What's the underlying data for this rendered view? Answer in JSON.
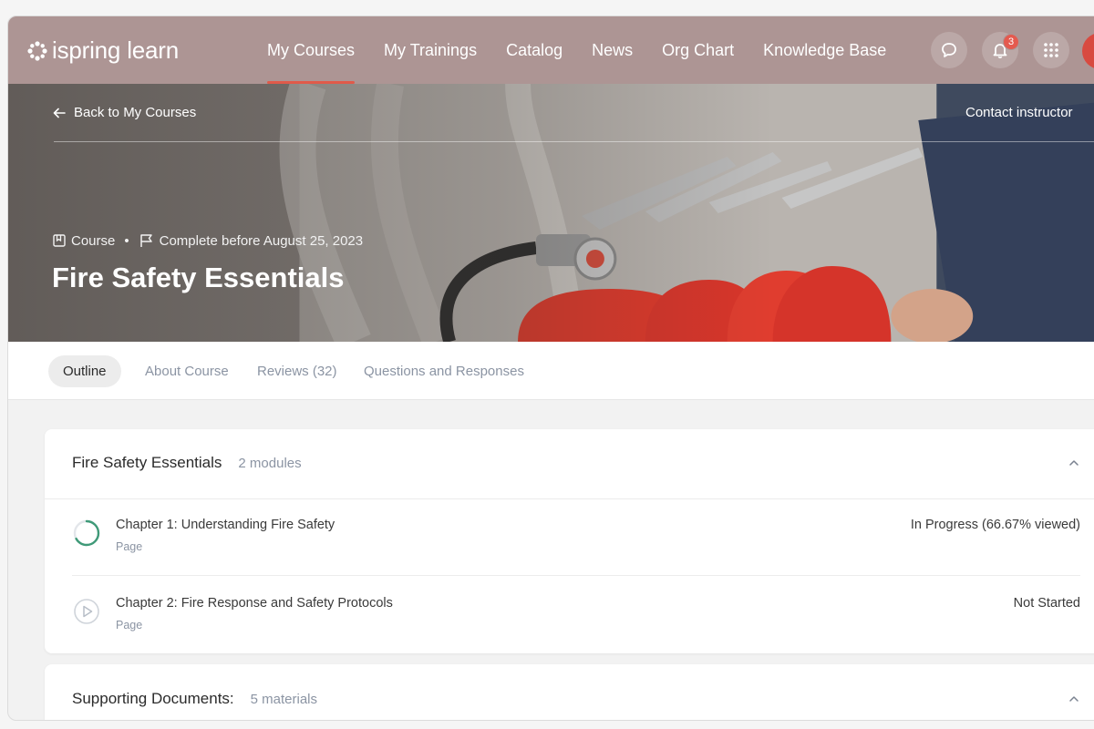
{
  "app": {
    "logo_text": "ispring learn"
  },
  "nav": {
    "items": [
      {
        "label": "My Courses",
        "active": true
      },
      {
        "label": "My Trainings"
      },
      {
        "label": "Catalog"
      },
      {
        "label": "News"
      },
      {
        "label": "Org Chart"
      },
      {
        "label": "Knowledge Base"
      }
    ],
    "notifications_count": "3",
    "icons": [
      "chat-bubble-icon",
      "bell-icon",
      "apps-grid-icon",
      "avatar"
    ]
  },
  "hero": {
    "back_label": "Back to My Courses",
    "contact_label": "Contact instructor",
    "type_label": "Course",
    "deadline_label": "Complete before August 25, 2023",
    "title": "Fire Safety Essentials"
  },
  "tabs": [
    {
      "label": "Outline",
      "active": true
    },
    {
      "label": "About Course"
    },
    {
      "label": "Reviews (32)"
    },
    {
      "label": "Questions and Responses"
    }
  ],
  "sections": [
    {
      "title": "Fire Safety Essentials",
      "count": "2 modules",
      "items": [
        {
          "title": "Chapter 1: Understanding Fire Safety",
          "type": "Page",
          "status": "In Progress (66.67% viewed)",
          "progress": 0.6667
        },
        {
          "title": "Chapter 2: Fire Response and Safety Protocols",
          "type": "Page",
          "status": "Not Started",
          "progress": 0
        }
      ]
    },
    {
      "title": "Supporting Documents:",
      "count": "5 materials"
    }
  ],
  "colors": {
    "topbar": "#ad9594",
    "accent": "#e05a4a",
    "progress": "#3f9a78"
  }
}
